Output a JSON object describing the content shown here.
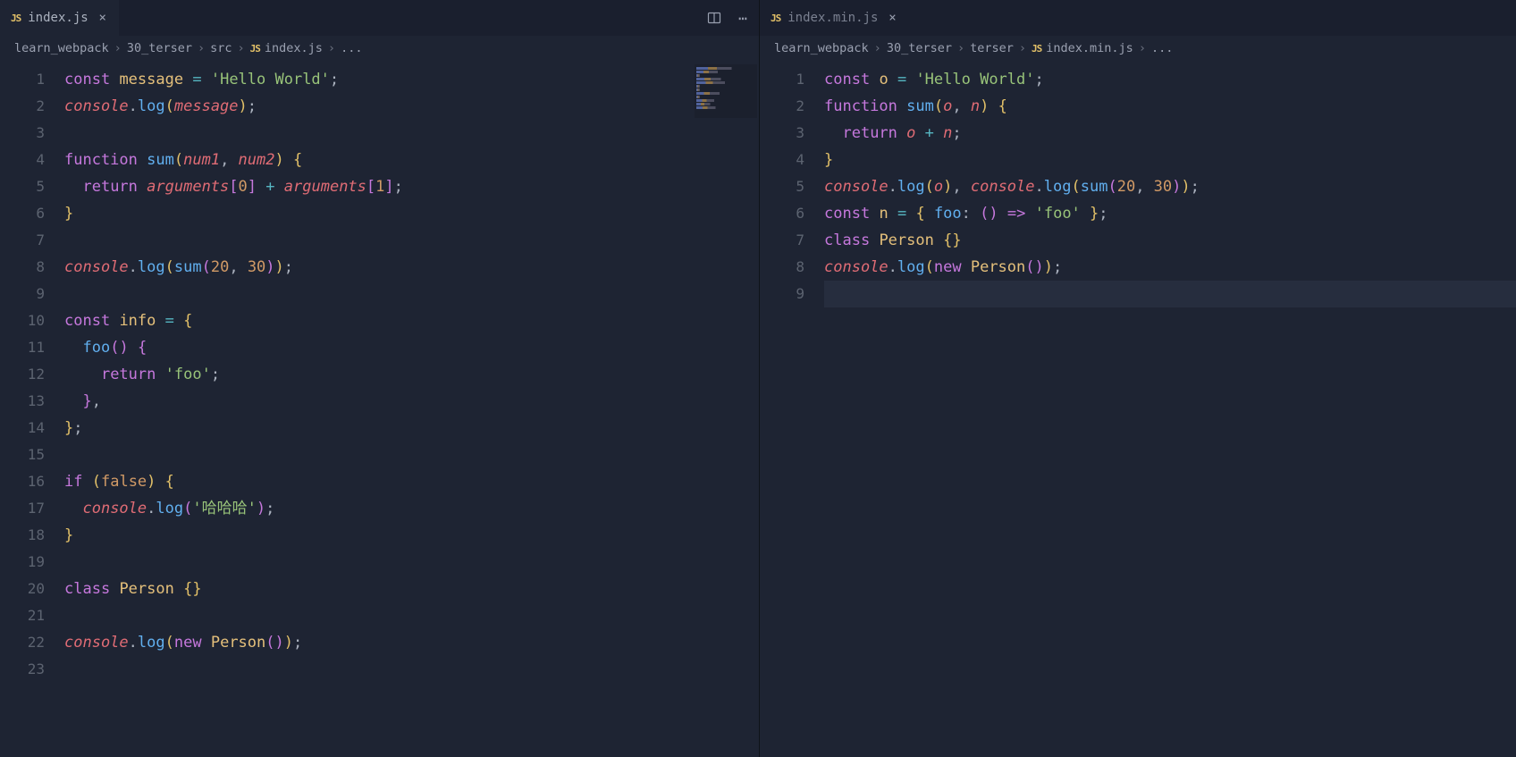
{
  "left": {
    "tab": {
      "icon": "JS",
      "label": "index.js",
      "close": "×"
    },
    "breadcrumb": [
      "learn_webpack",
      "30_terser",
      "src",
      {
        "icon": "JS",
        "text": "index.js"
      },
      "..."
    ],
    "lines": [
      1,
      2,
      3,
      4,
      5,
      6,
      7,
      8,
      9,
      10,
      11,
      12,
      13,
      14,
      15,
      16,
      17,
      18,
      19,
      20,
      21,
      22,
      23
    ],
    "code": [
      [
        {
          "t": "kw",
          "v": "const"
        },
        {
          "t": "sp",
          "v": " "
        },
        {
          "t": "var",
          "v": "message"
        },
        {
          "t": "sp",
          "v": " "
        },
        {
          "t": "op",
          "v": "="
        },
        {
          "t": "sp",
          "v": " "
        },
        {
          "t": "str",
          "v": "'Hello World'"
        },
        {
          "t": "pn",
          "v": ";"
        }
      ],
      [
        {
          "t": "nm",
          "v": "console"
        },
        {
          "t": "pn",
          "v": "."
        },
        {
          "t": "fn",
          "v": "log"
        },
        {
          "t": "pny",
          "v": "("
        },
        {
          "t": "nm",
          "v": "message"
        },
        {
          "t": "pny",
          "v": ")"
        },
        {
          "t": "pn",
          "v": ";"
        }
      ],
      [],
      [
        {
          "t": "kw",
          "v": "function"
        },
        {
          "t": "sp",
          "v": " "
        },
        {
          "t": "fn",
          "v": "sum"
        },
        {
          "t": "pny",
          "v": "("
        },
        {
          "t": "nm",
          "v": "num1"
        },
        {
          "t": "pn",
          "v": ", "
        },
        {
          "t": "nm",
          "v": "num2"
        },
        {
          "t": "pny",
          "v": ")"
        },
        {
          "t": "sp",
          "v": " "
        },
        {
          "t": "pny",
          "v": "{"
        }
      ],
      [
        {
          "t": "sp",
          "v": "  "
        },
        {
          "t": "kw",
          "v": "return"
        },
        {
          "t": "sp",
          "v": " "
        },
        {
          "t": "nm",
          "v": "arguments"
        },
        {
          "t": "pnp",
          "v": "["
        },
        {
          "t": "num",
          "v": "0"
        },
        {
          "t": "pnp",
          "v": "]"
        },
        {
          "t": "sp",
          "v": " "
        },
        {
          "t": "op",
          "v": "+"
        },
        {
          "t": "sp",
          "v": " "
        },
        {
          "t": "nm",
          "v": "arguments"
        },
        {
          "t": "pnp",
          "v": "["
        },
        {
          "t": "num",
          "v": "1"
        },
        {
          "t": "pnp",
          "v": "]"
        },
        {
          "t": "pn",
          "v": ";"
        }
      ],
      [
        {
          "t": "pny",
          "v": "}"
        }
      ],
      [],
      [
        {
          "t": "nm",
          "v": "console"
        },
        {
          "t": "pn",
          "v": "."
        },
        {
          "t": "fn",
          "v": "log"
        },
        {
          "t": "pny",
          "v": "("
        },
        {
          "t": "fn",
          "v": "sum"
        },
        {
          "t": "pnp",
          "v": "("
        },
        {
          "t": "num",
          "v": "20"
        },
        {
          "t": "pn",
          "v": ", "
        },
        {
          "t": "num",
          "v": "30"
        },
        {
          "t": "pnp",
          "v": ")"
        },
        {
          "t": "pny",
          "v": ")"
        },
        {
          "t": "pn",
          "v": ";"
        }
      ],
      [],
      [
        {
          "t": "kw",
          "v": "const"
        },
        {
          "t": "sp",
          "v": " "
        },
        {
          "t": "var",
          "v": "info"
        },
        {
          "t": "sp",
          "v": " "
        },
        {
          "t": "op",
          "v": "="
        },
        {
          "t": "sp",
          "v": " "
        },
        {
          "t": "pny",
          "v": "{"
        }
      ],
      [
        {
          "t": "sp",
          "v": "  "
        },
        {
          "t": "fn",
          "v": "foo"
        },
        {
          "t": "pnp",
          "v": "()"
        },
        {
          "t": "sp",
          "v": " "
        },
        {
          "t": "pnp",
          "v": "{"
        }
      ],
      [
        {
          "t": "sp",
          "v": "    "
        },
        {
          "t": "kw",
          "v": "return"
        },
        {
          "t": "sp",
          "v": " "
        },
        {
          "t": "str",
          "v": "'foo'"
        },
        {
          "t": "pn",
          "v": ";"
        }
      ],
      [
        {
          "t": "sp",
          "v": "  "
        },
        {
          "t": "pnp",
          "v": "}"
        },
        {
          "t": "pn",
          "v": ","
        }
      ],
      [
        {
          "t": "pny",
          "v": "}"
        },
        {
          "t": "pn",
          "v": ";"
        }
      ],
      [],
      [
        {
          "t": "kw",
          "v": "if"
        },
        {
          "t": "sp",
          "v": " "
        },
        {
          "t": "pny",
          "v": "("
        },
        {
          "t": "bool",
          "v": "false"
        },
        {
          "t": "pny",
          "v": ")"
        },
        {
          "t": "sp",
          "v": " "
        },
        {
          "t": "pny",
          "v": "{"
        }
      ],
      [
        {
          "t": "sp",
          "v": "  "
        },
        {
          "t": "nm",
          "v": "console"
        },
        {
          "t": "pn",
          "v": "."
        },
        {
          "t": "fn",
          "v": "log"
        },
        {
          "t": "pnp",
          "v": "("
        },
        {
          "t": "str",
          "v": "'哈哈哈'"
        },
        {
          "t": "pnp",
          "v": ")"
        },
        {
          "t": "pn",
          "v": ";"
        }
      ],
      [
        {
          "t": "pny",
          "v": "}"
        }
      ],
      [],
      [
        {
          "t": "kw",
          "v": "class"
        },
        {
          "t": "sp",
          "v": " "
        },
        {
          "t": "var",
          "v": "Person"
        },
        {
          "t": "sp",
          "v": " "
        },
        {
          "t": "pny",
          "v": "{}"
        }
      ],
      [],
      [
        {
          "t": "nm",
          "v": "console"
        },
        {
          "t": "pn",
          "v": "."
        },
        {
          "t": "fn",
          "v": "log"
        },
        {
          "t": "pny",
          "v": "("
        },
        {
          "t": "kw",
          "v": "new"
        },
        {
          "t": "sp",
          "v": " "
        },
        {
          "t": "var",
          "v": "Person"
        },
        {
          "t": "pnp",
          "v": "()"
        },
        {
          "t": "pny",
          "v": ")"
        },
        {
          "t": "pn",
          "v": ";"
        }
      ],
      []
    ]
  },
  "right": {
    "tab": {
      "icon": "JS",
      "label": "index.min.js",
      "close": "×"
    },
    "breadcrumb": [
      "learn_webpack",
      "30_terser",
      "terser",
      {
        "icon": "JS",
        "text": "index.min.js"
      },
      "..."
    ],
    "lines": [
      1,
      2,
      3,
      4,
      5,
      6,
      7,
      8,
      9
    ],
    "cursorLine": 9,
    "code": [
      [
        {
          "t": "kw",
          "v": "const"
        },
        {
          "t": "sp",
          "v": " "
        },
        {
          "t": "var",
          "v": "o"
        },
        {
          "t": "sp",
          "v": " "
        },
        {
          "t": "op",
          "v": "="
        },
        {
          "t": "sp",
          "v": " "
        },
        {
          "t": "str",
          "v": "'Hello World'"
        },
        {
          "t": "pn",
          "v": ";"
        }
      ],
      [
        {
          "t": "kw",
          "v": "function"
        },
        {
          "t": "sp",
          "v": " "
        },
        {
          "t": "fn",
          "v": "sum"
        },
        {
          "t": "pny",
          "v": "("
        },
        {
          "t": "nm",
          "v": "o"
        },
        {
          "t": "pn",
          "v": ", "
        },
        {
          "t": "nm",
          "v": "n"
        },
        {
          "t": "pny",
          "v": ")"
        },
        {
          "t": "sp",
          "v": " "
        },
        {
          "t": "pny",
          "v": "{"
        }
      ],
      [
        {
          "t": "sp",
          "v": "  "
        },
        {
          "t": "kw",
          "v": "return"
        },
        {
          "t": "sp",
          "v": " "
        },
        {
          "t": "nm",
          "v": "o"
        },
        {
          "t": "sp",
          "v": " "
        },
        {
          "t": "op",
          "v": "+"
        },
        {
          "t": "sp",
          "v": " "
        },
        {
          "t": "nm",
          "v": "n"
        },
        {
          "t": "pn",
          "v": ";"
        }
      ],
      [
        {
          "t": "pny",
          "v": "}"
        }
      ],
      [
        {
          "t": "nm",
          "v": "console"
        },
        {
          "t": "pn",
          "v": "."
        },
        {
          "t": "fn",
          "v": "log"
        },
        {
          "t": "pny",
          "v": "("
        },
        {
          "t": "nm",
          "v": "o"
        },
        {
          "t": "pny",
          "v": ")"
        },
        {
          "t": "pn",
          "v": ", "
        },
        {
          "t": "nm",
          "v": "console"
        },
        {
          "t": "pn",
          "v": "."
        },
        {
          "t": "fn",
          "v": "log"
        },
        {
          "t": "pny",
          "v": "("
        },
        {
          "t": "fn",
          "v": "sum"
        },
        {
          "t": "pnp",
          "v": "("
        },
        {
          "t": "num",
          "v": "20"
        },
        {
          "t": "pn",
          "v": ", "
        },
        {
          "t": "num",
          "v": "30"
        },
        {
          "t": "pnp",
          "v": ")"
        },
        {
          "t": "pny",
          "v": ")"
        },
        {
          "t": "pn",
          "v": ";"
        }
      ],
      [
        {
          "t": "kw",
          "v": "const"
        },
        {
          "t": "sp",
          "v": " "
        },
        {
          "t": "var",
          "v": "n"
        },
        {
          "t": "sp",
          "v": " "
        },
        {
          "t": "op",
          "v": "="
        },
        {
          "t": "sp",
          "v": " "
        },
        {
          "t": "pny",
          "v": "{"
        },
        {
          "t": "sp",
          "v": " "
        },
        {
          "t": "fn",
          "v": "foo"
        },
        {
          "t": "pn",
          "v": ": "
        },
        {
          "t": "pnp",
          "v": "()"
        },
        {
          "t": "sp",
          "v": " "
        },
        {
          "t": "kw",
          "v": "=>"
        },
        {
          "t": "sp",
          "v": " "
        },
        {
          "t": "str",
          "v": "'foo'"
        },
        {
          "t": "sp",
          "v": " "
        },
        {
          "t": "pny",
          "v": "}"
        },
        {
          "t": "pn",
          "v": ";"
        }
      ],
      [
        {
          "t": "kw",
          "v": "class"
        },
        {
          "t": "sp",
          "v": " "
        },
        {
          "t": "var",
          "v": "Person"
        },
        {
          "t": "sp",
          "v": " "
        },
        {
          "t": "pny",
          "v": "{}"
        }
      ],
      [
        {
          "t": "nm",
          "v": "console"
        },
        {
          "t": "pn",
          "v": "."
        },
        {
          "t": "fn",
          "v": "log"
        },
        {
          "t": "pny",
          "v": "("
        },
        {
          "t": "kw",
          "v": "new"
        },
        {
          "t": "sp",
          "v": " "
        },
        {
          "t": "var",
          "v": "Person"
        },
        {
          "t": "pnp",
          "v": "()"
        },
        {
          "t": "pny",
          "v": ")"
        },
        {
          "t": "pn",
          "v": ";"
        }
      ],
      []
    ]
  },
  "icons": {
    "split": "▯▯",
    "more": "⋯",
    "sep": "›"
  }
}
